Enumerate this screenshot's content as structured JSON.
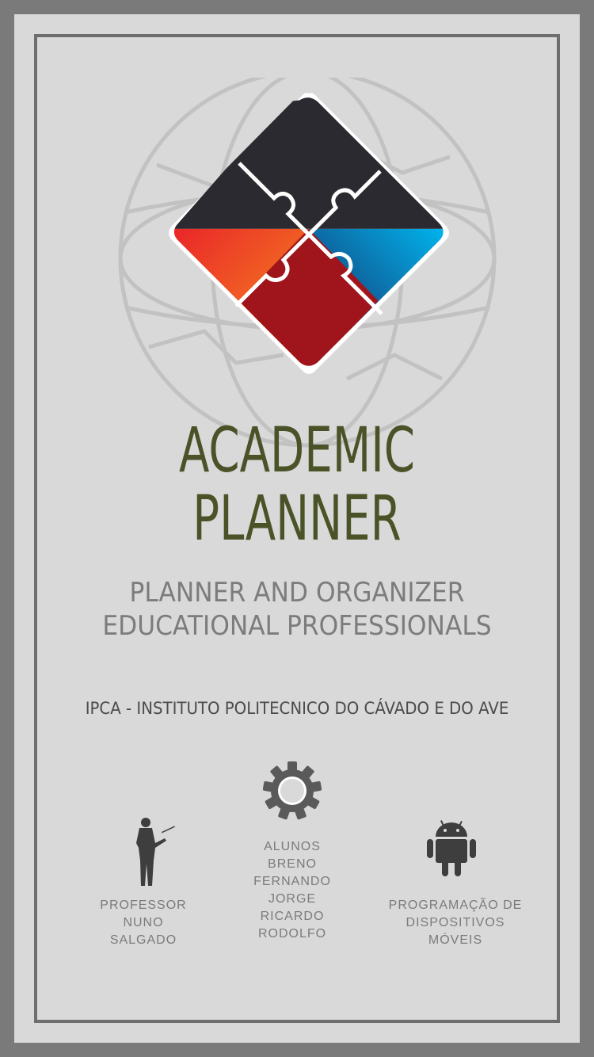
{
  "title": {
    "line1": "ACADEMIC",
    "line2": "PLANNER"
  },
  "subtitle": {
    "line1": "PLANNER AND ORGANIZER",
    "line2": "EDUCATIONAL PROFESSIONALS"
  },
  "institution": "IPCA - INSTITUTO POLITECNICO DO CÁVADO E DO AVE",
  "professor": {
    "lines": [
      "PROFESSOR",
      "NUNO",
      "SALGADO"
    ],
    "icon": "presenter-icon"
  },
  "students": {
    "lines": [
      "ALUNOS",
      "BRENO",
      "FERNANDO",
      "JORGE",
      "RICARDO",
      "RODOLFO"
    ],
    "icon": "gear-icon"
  },
  "course": {
    "lines": [
      "PROGRAMAÇÃO DE",
      "DISPOSITIVOS",
      "MÓVEIS"
    ],
    "icon": "android-icon"
  },
  "colors": {
    "background": "#d9d9d9",
    "outer": "#7a7a7a",
    "title": "#4a5228",
    "subtitle": "#7c7c7c",
    "puzzle_dark": "#2b2a30",
    "puzzle_blue": "#00aeef",
    "puzzle_red": "#a0141c",
    "puzzle_orange": "#f7941d"
  }
}
